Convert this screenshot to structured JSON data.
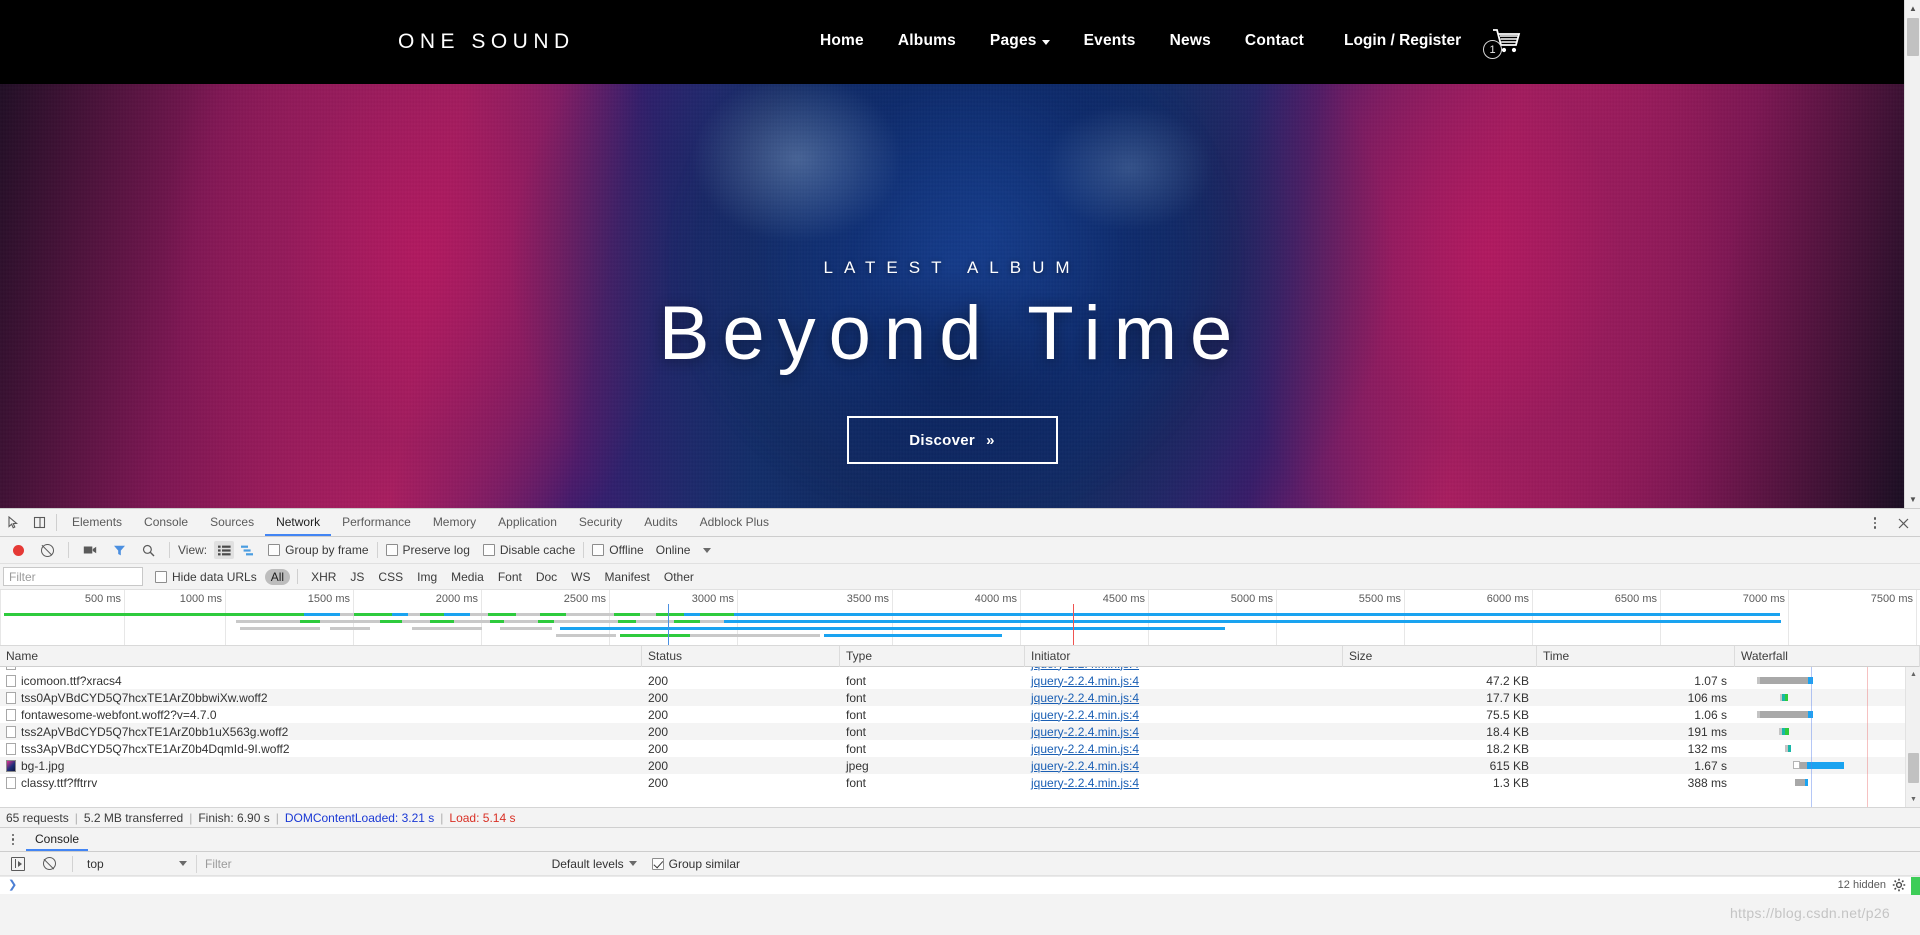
{
  "site": {
    "brand": "ONE SOUND",
    "nav": [
      {
        "label": "Home",
        "dropdown": false
      },
      {
        "label": "Albums",
        "dropdown": false
      },
      {
        "label": "Pages",
        "dropdown": true
      },
      {
        "label": "Events",
        "dropdown": false
      },
      {
        "label": "News",
        "dropdown": false
      },
      {
        "label": "Contact",
        "dropdown": false
      }
    ],
    "auth_label": "Login / Register",
    "cart_count": "1",
    "hero": {
      "kicker": "LATEST ALBUM",
      "title": "Beyond Time",
      "cta_label": "Discover",
      "cta_icon": "»"
    }
  },
  "devtools": {
    "tabs": [
      {
        "label": "Elements",
        "active": false
      },
      {
        "label": "Console",
        "active": false
      },
      {
        "label": "Sources",
        "active": false
      },
      {
        "label": "Network",
        "active": true
      },
      {
        "label": "Performance",
        "active": false
      },
      {
        "label": "Memory",
        "active": false
      },
      {
        "label": "Application",
        "active": false
      },
      {
        "label": "Security",
        "active": false
      },
      {
        "label": "Audits",
        "active": false
      },
      {
        "label": "Adblock Plus",
        "active": false
      }
    ],
    "network_toolbar": {
      "view_label": "View:",
      "group_by_frame": {
        "label": "Group by frame",
        "checked": false
      },
      "preserve_log": {
        "label": "Preserve log",
        "checked": false
      },
      "disable_cache": {
        "label": "Disable cache",
        "checked": false
      },
      "offline": {
        "label": "Offline",
        "checked": false
      },
      "throttling": "Online"
    },
    "filter_bar": {
      "filter_placeholder": "Filter",
      "filter_value": "",
      "hide_data_urls": {
        "label": "Hide data URLs",
        "checked": false
      },
      "types": [
        "All",
        "XHR",
        "JS",
        "CSS",
        "Img",
        "Media",
        "Font",
        "Doc",
        "WS",
        "Manifest",
        "Other"
      ],
      "active_type": "All"
    },
    "timeline_ticks": [
      "500 ms",
      "1000 ms",
      "1500 ms",
      "2000 ms",
      "2500 ms",
      "3000 ms",
      "3500 ms",
      "4000 ms",
      "4500 ms",
      "5000 ms",
      "5500 ms",
      "6000 ms",
      "6500 ms",
      "7000 ms",
      "7500 ms"
    ],
    "columns": [
      "Name",
      "Status",
      "Type",
      "Initiator",
      "Size",
      "Time",
      "Waterfall"
    ],
    "requests": [
      {
        "name": "icomoon.ttf?xracs4",
        "status": "200",
        "type": "font",
        "initiator": "jquery-2.2.4.min.js:4",
        "size": "47.2 KB",
        "time": "1.07 s",
        "icon": "file-icon",
        "wf_start": 18,
        "wf_wait": 42,
        "wf_dl": 8,
        "wf_color": "#a1a1a1"
      },
      {
        "name": "tss0ApVBdCYD5Q7hcxTE1ArZ0bbwiXw.woff2",
        "status": "200",
        "type": "font",
        "initiator": "jquery-2.2.4.min.js:4",
        "size": "17.7 KB",
        "time": "106 ms",
        "icon": "file-icon",
        "wf_start": 22,
        "wf_wait": 2,
        "wf_dl": 4,
        "wf_color": "#a1a1a1"
      },
      {
        "name": "fontawesome-webfont.woff2?v=4.7.0",
        "status": "200",
        "type": "font",
        "initiator": "jquery-2.2.4.min.js:4",
        "size": "75.5 KB",
        "time": "1.06 s",
        "icon": "file-icon",
        "wf_start": 18,
        "wf_wait": 42,
        "wf_dl": 8,
        "wf_color": "#a1a1a1"
      },
      {
        "name": "tss2ApVBdCYD5Q7hcxTE1ArZ0bb1uX563g.woff2",
        "status": "200",
        "type": "font",
        "initiator": "jquery-2.2.4.min.js:4",
        "size": "18.4 KB",
        "time": "191 ms",
        "icon": "file-icon",
        "wf_start": 22,
        "wf_wait": 3,
        "wf_dl": 5,
        "wf_color": "#a1a1a1"
      },
      {
        "name": "tss3ApVBdCYD5Q7hcxTE1ArZ0b4DqmId-9I.woff2",
        "status": "200",
        "type": "font",
        "initiator": "jquery-2.2.4.min.js:4",
        "size": "18.2 KB",
        "time": "132 ms",
        "icon": "file-icon",
        "wf_start": 26,
        "wf_wait": 2,
        "wf_dl": 4,
        "wf_color": "#a1a1a1"
      },
      {
        "name": "bg-1.jpg",
        "status": "200",
        "type": "jpeg",
        "initiator": "jquery-2.2.4.min.js:4",
        "size": "615 KB",
        "time": "1.67 s",
        "icon": "image-icon",
        "wf_start": 34,
        "wf_wait": 8,
        "wf_dl": 42,
        "wf_color": "#8d8d8d"
      },
      {
        "name": "classy.ttf?fftrrv",
        "status": "200",
        "type": "font",
        "initiator": "jquery-2.2.4.min.js:4",
        "size": "1.3 KB",
        "time": "388 ms",
        "icon": "file-icon",
        "wf_start": 36,
        "wf_wait": 8,
        "wf_dl": 3,
        "wf_color": "#a1a1a1"
      }
    ],
    "status_bar": {
      "requests": "65 requests",
      "transferred": "5.2 MB transferred",
      "finish": "Finish: 6.90 s",
      "dom_content_loaded": "DOMContentLoaded: 3.21 s",
      "load": "Load: 5.14 s"
    },
    "drawer": {
      "tab_label": "Console",
      "context": "top",
      "filter_placeholder": "Filter",
      "filter_value": "",
      "levels_label": "Default levels",
      "group_similar": {
        "label": "Group similar",
        "checked": true
      },
      "hidden_label": "12 hidden"
    }
  },
  "watermark": "https://blog.csdn.net/p26",
  "colors": {
    "accent_blue": "#4285f4",
    "record_red": "#e53935",
    "dcl_blue": "#1a38d4",
    "load_red": "#d93025",
    "waterfall_blue": "#1aa3f0",
    "waterfall_green": "#12b34b"
  }
}
